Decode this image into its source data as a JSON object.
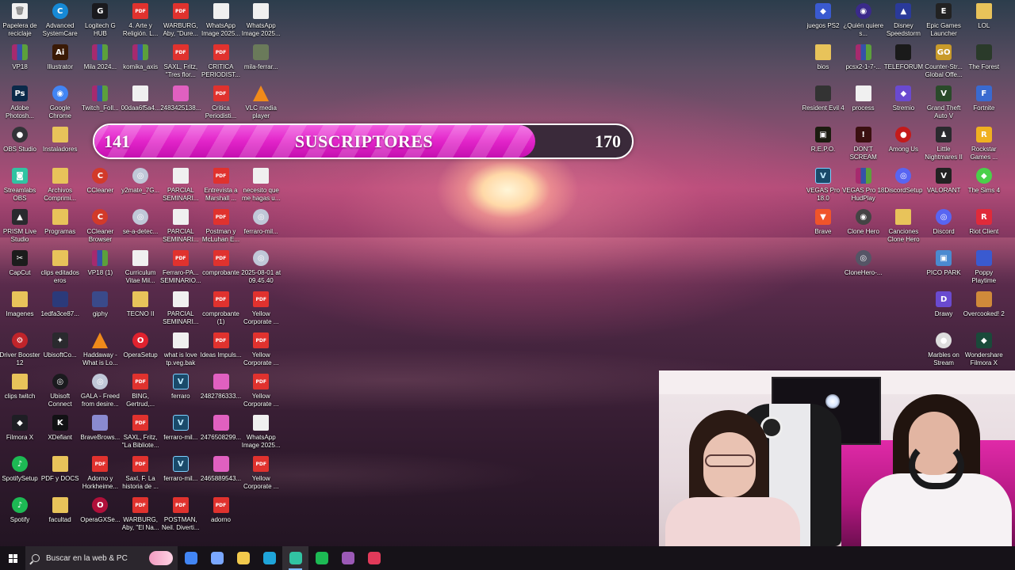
{
  "subscriber_bar": {
    "start_value": "141",
    "label": "SUSCRIPTORES",
    "goal_value": "170",
    "progress_fraction": 0.82
  },
  "taskbar": {
    "search_placeholder": "Buscar en la web & PC",
    "apps": [
      {
        "name": "chrome-app",
        "color": "#4285f4"
      },
      {
        "name": "copilot-app",
        "color": "#7aa7ff"
      },
      {
        "name": "file-explorer-app",
        "color": "#f2c94c"
      },
      {
        "name": "edge-app",
        "color": "#1fa4d9"
      },
      {
        "name": "streamlabs-app",
        "color": "#31c3a2"
      },
      {
        "name": "spotify-app",
        "color": "#1db954"
      },
      {
        "name": "obs-app",
        "color": "#9b59b6"
      },
      {
        "name": "capcut-app",
        "color": "#e23a5a"
      }
    ]
  },
  "desktop_icons": [
    {
      "label": "Papelera de reciclaje",
      "glyph": "🗑",
      "kind": "doc",
      "col": 0,
      "row": 0
    },
    {
      "label": "VP18",
      "glyph": "",
      "kind": "rar",
      "col": 0,
      "row": 1
    },
    {
      "label": "Adobe Photosh...",
      "glyph": "Ps",
      "kind": "app",
      "color": "#0b2a4a",
      "col": 0,
      "row": 2
    },
    {
      "label": "OBS Studio",
      "glyph": "●",
      "kind": "circ",
      "color": "#333338",
      "col": 0,
      "row": 3
    },
    {
      "label": "Streamlabs OBS",
      "glyph": "◙",
      "kind": "app",
      "color": "#31c3a2",
      "col": 0,
      "row": 4
    },
    {
      "label": "PRISM Live Studio",
      "glyph": "▲",
      "kind": "app",
      "color": "#2a2a2e",
      "col": 0,
      "row": 5
    },
    {
      "label": "CapCut",
      "glyph": "✂",
      "kind": "app",
      "color": "#1c1c1c",
      "col": 0,
      "row": 6
    },
    {
      "label": "Imagenes",
      "glyph": "",
      "kind": "folder",
      "col": 0,
      "row": 7
    },
    {
      "label": "Driver Booster 12",
      "glyph": "⚙",
      "kind": "circ",
      "color": "#c0242a",
      "col": 0,
      "row": 8
    },
    {
      "label": "clips twitch",
      "glyph": "",
      "kind": "folder",
      "col": 0,
      "row": 9
    },
    {
      "label": "Filmora X",
      "glyph": "◆",
      "kind": "app",
      "color": "#1e1e24",
      "col": 0,
      "row": 10
    },
    {
      "label": "SpotifySetup",
      "glyph": "♪",
      "kind": "circ",
      "color": "#1db954",
      "col": 0,
      "row": 11
    },
    {
      "label": "Spotify",
      "glyph": "♪",
      "kind": "circ",
      "color": "#1db954",
      "col": 0,
      "row": 12
    },
    {
      "label": "Advanced SystemCare",
      "glyph": "C",
      "kind": "circ",
      "color": "#1689d6",
      "col": 1,
      "row": 0
    },
    {
      "label": "Illustrator",
      "glyph": "Ai",
      "kind": "app",
      "color": "#3a1a06",
      "col": 1,
      "row": 1
    },
    {
      "label": "Google Chrome",
      "glyph": "◉",
      "kind": "circ",
      "color": "#4285f4",
      "col": 1,
      "row": 2
    },
    {
      "label": "Instaladores",
      "glyph": "",
      "kind": "folder",
      "col": 1,
      "row": 3
    },
    {
      "label": "Archivos Comprimi...",
      "glyph": "",
      "kind": "folder",
      "col": 1,
      "row": 4
    },
    {
      "label": "Programas",
      "glyph": "",
      "kind": "folder",
      "col": 1,
      "row": 5
    },
    {
      "label": "clips editados eros",
      "glyph": "",
      "kind": "folder",
      "col": 1,
      "row": 6
    },
    {
      "label": "1edfa3ce87...",
      "glyph": "",
      "kind": "app",
      "color": "#2b3a7a",
      "col": 1,
      "row": 7
    },
    {
      "label": "UbisoftCo...",
      "glyph": "✦",
      "kind": "app",
      "color": "#2a2a2e",
      "col": 1,
      "row": 8
    },
    {
      "label": "Ubisoft Connect",
      "glyph": "◎",
      "kind": "circ",
      "color": "#1a1a1e",
      "col": 1,
      "row": 9
    },
    {
      "label": "XDefiant",
      "glyph": "K",
      "kind": "app",
      "color": "#111114",
      "col": 1,
      "row": 10
    },
    {
      "label": "PDF y DOCS",
      "glyph": "",
      "kind": "folder",
      "col": 1,
      "row": 11
    },
    {
      "label": "facultad",
      "glyph": "",
      "kind": "folder",
      "col": 1,
      "row": 12
    },
    {
      "label": "Logitech G HUB",
      "glyph": "G",
      "kind": "app",
      "color": "#1a1a1e",
      "col": 2,
      "row": 0
    },
    {
      "label": "Mila 2024...",
      "glyph": "",
      "kind": "rar",
      "col": 2,
      "row": 1
    },
    {
      "label": "Twitch_Foll...",
      "glyph": "",
      "kind": "rar",
      "col": 2,
      "row": 2
    },
    {
      "label": "CCleaner",
      "glyph": "C",
      "kind": "circ",
      "color": "#d23a2a",
      "col": 2,
      "row": 4
    },
    {
      "label": "CCleaner Browser",
      "glyph": "C",
      "kind": "circ",
      "color": "#d23a2a",
      "col": 2,
      "row": 5
    },
    {
      "label": "VP18 (1)",
      "glyph": "",
      "kind": "rar",
      "col": 2,
      "row": 6
    },
    {
      "label": "giphy",
      "glyph": "",
      "kind": "app",
      "color": "#3a4a8a",
      "col": 2,
      "row": 7
    },
    {
      "label": "Haddaway - What is Lo...",
      "glyph": "",
      "kind": "vlc",
      "col": 2,
      "row": 8
    },
    {
      "label": "GALA - Freed from desire...",
      "glyph": "◎",
      "kind": "circ",
      "color": "#c0c8d8",
      "col": 2,
      "row": 9
    },
    {
      "label": "BraveBrows...",
      "glyph": "",
      "kind": "app",
      "color": "#8a8ad0",
      "col": 2,
      "row": 10
    },
    {
      "label": "Adorno y Horkheime...",
      "glyph": "PDF",
      "kind": "pdf",
      "col": 2,
      "row": 11
    },
    {
      "label": "OperaGXSe...",
      "glyph": "O",
      "kind": "circ",
      "color": "#b0103a",
      "col": 2,
      "row": 12
    },
    {
      "label": "4. Arte y Religión. L...",
      "glyph": "PDF",
      "kind": "pdf",
      "col": 3,
      "row": 0
    },
    {
      "label": "komika_axis",
      "glyph": "",
      "kind": "rar",
      "col": 3,
      "row": 1
    },
    {
      "label": "00daa6f5a4...",
      "glyph": "",
      "kind": "doc",
      "col": 3,
      "row": 2
    },
    {
      "label": "y2mate_7G...",
      "glyph": "◎",
      "kind": "circ",
      "color": "#c0c8d8",
      "col": 3,
      "row": 4
    },
    {
      "label": "se-a-detec...",
      "glyph": "◎",
      "kind": "circ",
      "color": "#c0c8d8",
      "col": 3,
      "row": 5
    },
    {
      "label": "Curriculum Vitae Mil...",
      "glyph": "",
      "kind": "doc",
      "col": 3,
      "row": 6
    },
    {
      "label": "TECNO II",
      "glyph": "",
      "kind": "folder",
      "col": 3,
      "row": 7
    },
    {
      "label": "OperaSetup",
      "glyph": "O",
      "kind": "circ",
      "color": "#e0222e",
      "col": 3,
      "row": 8
    },
    {
      "label": "BING, Gertrud,...",
      "glyph": "PDF",
      "kind": "pdf",
      "col": 3,
      "row": 9
    },
    {
      "label": "SAXL, Fritz, \"La Bibliote...",
      "glyph": "PDF",
      "kind": "pdf",
      "col": 3,
      "row": 10
    },
    {
      "label": "Saxl, F. La historia de ...",
      "glyph": "PDF",
      "kind": "pdf",
      "col": 3,
      "row": 11
    },
    {
      "label": "WARBURG, Aby, \"El Na...",
      "glyph": "PDF",
      "kind": "pdf",
      "col": 3,
      "row": 12
    },
    {
      "label": "WARBURG, Aby, \"Dure...",
      "glyph": "PDF",
      "kind": "pdf",
      "col": 4,
      "row": 0
    },
    {
      "label": "SAXL, Fritz, \"Tres flor...",
      "glyph": "PDF",
      "kind": "pdf",
      "col": 4,
      "row": 1
    },
    {
      "label": "2483425138...",
      "glyph": "",
      "kind": "app",
      "color": "#e060c0",
      "col": 4,
      "row": 2
    },
    {
      "label": "PARCIAL SEMINARI...",
      "glyph": "",
      "kind": "doc",
      "col": 4,
      "row": 4
    },
    {
      "label": "PARCIAL SEMINARI...",
      "glyph": "",
      "kind": "doc",
      "col": 4,
      "row": 5
    },
    {
      "label": "Ferraro-PA... SEMINARIO...",
      "glyph": "PDF",
      "kind": "pdf",
      "col": 4,
      "row": 6
    },
    {
      "label": "PARCIAL SEMINARI...",
      "glyph": "",
      "kind": "doc",
      "col": 4,
      "row": 7
    },
    {
      "label": "what is love tp.veg.bak",
      "glyph": "",
      "kind": "doc",
      "col": 4,
      "row": 8
    },
    {
      "label": "ferraro",
      "glyph": "V",
      "kind": "vegas",
      "col": 4,
      "row": 9
    },
    {
      "label": "ferraro-mil...",
      "glyph": "V",
      "kind": "vegas",
      "col": 4,
      "row": 10
    },
    {
      "label": "ferraro-mil...",
      "glyph": "V",
      "kind": "vegas",
      "col": 4,
      "row": 11
    },
    {
      "label": "POSTMAN, Neil. Diverti...",
      "glyph": "PDF",
      "kind": "pdf",
      "col": 4,
      "row": 12
    },
    {
      "label": "WhatsApp Image 2025...",
      "glyph": "",
      "kind": "doc",
      "col": 5,
      "row": 0
    },
    {
      "label": "CRITICA PERIODIST...",
      "glyph": "PDF",
      "kind": "pdf",
      "col": 5,
      "row": 1
    },
    {
      "label": "Critica Periodisti...",
      "glyph": "PDF",
      "kind": "pdf",
      "col": 5,
      "row": 2
    },
    {
      "label": "Entrevista a Marshall ...",
      "glyph": "PDF",
      "kind": "pdf",
      "col": 5,
      "row": 4
    },
    {
      "label": "Postman y McLuhan E...",
      "glyph": "PDF",
      "kind": "pdf",
      "col": 5,
      "row": 5
    },
    {
      "label": "comprobante",
      "glyph": "PDF",
      "kind": "pdf",
      "col": 5,
      "row": 6
    },
    {
      "label": "comprobante (1)",
      "glyph": "PDF",
      "kind": "pdf",
      "col": 5,
      "row": 7
    },
    {
      "label": "Ideas Impuls...",
      "glyph": "PDF",
      "kind": "pdf",
      "col": 5,
      "row": 8
    },
    {
      "label": "2482786333...",
      "glyph": "",
      "kind": "app",
      "color": "#e060c0",
      "col": 5,
      "row": 9
    },
    {
      "label": "2476508299...",
      "glyph": "",
      "kind": "app",
      "color": "#e060c0",
      "col": 5,
      "row": 10
    },
    {
      "label": "2465889543...",
      "glyph": "",
      "kind": "app",
      "color": "#e060c0",
      "col": 5,
      "row": 11
    },
    {
      "label": "adorno",
      "glyph": "PDF",
      "kind": "pdf",
      "col": 5,
      "row": 12
    },
    {
      "label": "WhatsApp Image 2025...",
      "glyph": "",
      "kind": "doc",
      "col": 6,
      "row": 0
    },
    {
      "label": "mila-ferrar...",
      "glyph": "",
      "kind": "app",
      "color": "#6a7a5a",
      "col": 6,
      "row": 1
    },
    {
      "label": "VLC media player",
      "glyph": "",
      "kind": "vlc",
      "col": 6,
      "row": 2
    },
    {
      "label": "necesito que me hagas u...",
      "glyph": "",
      "kind": "doc",
      "col": 6,
      "row": 4
    },
    {
      "label": "ferraro-mil...",
      "glyph": "◎",
      "kind": "circ",
      "color": "#c0c8d8",
      "col": 6,
      "row": 5
    },
    {
      "label": "2025-08-01 at 09.45.40",
      "glyph": "◎",
      "kind": "circ",
      "color": "#c0c8d8",
      "col": 6,
      "row": 6
    },
    {
      "label": "Yellow Corporate ...",
      "glyph": "PDF",
      "kind": "pdf",
      "col": 6,
      "row": 7
    },
    {
      "label": "Yellow Corporate ...",
      "glyph": "PDF",
      "kind": "pdf",
      "col": 6,
      "row": 8
    },
    {
      "label": "Yellow Corporate ...",
      "glyph": "PDF",
      "kind": "pdf",
      "col": 6,
      "row": 9
    },
    {
      "label": "WhatsApp Image 2025...",
      "glyph": "",
      "kind": "doc",
      "col": 6,
      "row": 10
    },
    {
      "label": "Yellow Corporate ...",
      "glyph": "PDF",
      "kind": "pdf",
      "col": 6,
      "row": 11
    }
  ],
  "right_icons": [
    {
      "label": "juegos PS2",
      "glyph": "◆",
      "kind": "app",
      "color": "#3a5ad0",
      "col": 0,
      "row": 0
    },
    {
      "label": "bios",
      "glyph": "",
      "kind": "folder",
      "col": 0,
      "row": 1
    },
    {
      "label": "Resident Evil 4",
      "glyph": "",
      "kind": "app",
      "color": "#333",
      "col": 0,
      "row": 2
    },
    {
      "label": "R.E.P.O.",
      "glyph": "▣",
      "kind": "app",
      "color": "#1c1c10",
      "col": 0,
      "row": 3
    },
    {
      "label": "VEGAS Pro 18.0",
      "glyph": "V",
      "kind": "vegas",
      "col": 0,
      "row": 4
    },
    {
      "label": "Brave",
      "glyph": "▼",
      "kind": "app",
      "color": "#f0542a",
      "col": 0,
      "row": 5
    },
    {
      "label": "¿Quién quiere s...",
      "glyph": "◉",
      "kind": "circ",
      "color": "#3a2a8a",
      "col": 1,
      "row": 0
    },
    {
      "label": "pcsx2-1-7-...",
      "glyph": "",
      "kind": "rar",
      "col": 1,
      "row": 1
    },
    {
      "label": "process",
      "glyph": "",
      "kind": "doc",
      "col": 1,
      "row": 2
    },
    {
      "label": "DON'T SCREAM",
      "glyph": "!",
      "kind": "app",
      "color": "#3a1010",
      "col": 1,
      "row": 3
    },
    {
      "label": "VEGAS Pro 18 HudPlay",
      "glyph": "",
      "kind": "rar",
      "col": 1,
      "row": 4
    },
    {
      "label": "Clone Hero",
      "glyph": "◉",
      "kind": "circ",
      "color": "#444",
      "col": 1,
      "row": 5
    },
    {
      "label": "CloneHero-...",
      "glyph": "◎",
      "kind": "circ",
      "color": "#556",
      "col": 1,
      "row": 6
    },
    {
      "label": "Disney Speedstorm",
      "glyph": "▲",
      "kind": "app",
      "color": "#2a3a9a",
      "col": 2,
      "row": 0
    },
    {
      "label": "TELEFORUM",
      "glyph": "",
      "kind": "app",
      "color": "#1a1a1a",
      "col": 2,
      "row": 1
    },
    {
      "label": "Stremio",
      "glyph": "◆",
      "kind": "app",
      "color": "#6a4ad0",
      "col": 2,
      "row": 2
    },
    {
      "label": "Among Us",
      "glyph": "●",
      "kind": "circ",
      "color": "#c41a1a",
      "col": 2,
      "row": 3
    },
    {
      "label": "DiscordSetup",
      "glyph": "◎",
      "kind": "circ",
      "color": "#5865f2",
      "col": 2,
      "row": 4
    },
    {
      "label": "Canciones Clone Hero",
      "glyph": "",
      "kind": "folder",
      "col": 2,
      "row": 5
    },
    {
      "label": "Epic Games Launcher",
      "glyph": "E",
      "kind": "app",
      "color": "#222",
      "col": 3,
      "row": 0
    },
    {
      "label": "Counter-Str... Global Offe...",
      "glyph": "GO",
      "kind": "app",
      "color": "#c89a2a",
      "col": 3,
      "row": 1
    },
    {
      "label": "Grand Theft Auto V",
      "glyph": "V",
      "kind": "app",
      "color": "#2a4a2a",
      "col": 3,
      "row": 2
    },
    {
      "label": "Little Nightmares II",
      "glyph": "♟",
      "kind": "app",
      "color": "#2a2a2e",
      "col": 3,
      "row": 3
    },
    {
      "label": "VALORANT",
      "glyph": "V",
      "kind": "app",
      "color": "#222",
      "col": 3,
      "row": 4
    },
    {
      "label": "Discord",
      "glyph": "◎",
      "kind": "circ",
      "color": "#5865f2",
      "col": 3,
      "row": 5
    },
    {
      "label": "PICO PARK",
      "glyph": "▣",
      "kind": "app",
      "color": "#4a8ad0",
      "col": 3,
      "row": 6
    },
    {
      "label": "Drawy",
      "glyph": "D",
      "kind": "app",
      "color": "#6a4ad0",
      "col": 3,
      "row": 7
    },
    {
      "label": "Marbles on Stream",
      "glyph": "●",
      "kind": "circ",
      "color": "#ddd",
      "col": 3,
      "row": 8
    },
    {
      "label": "LOL",
      "glyph": "",
      "kind": "folder",
      "col": 4,
      "row": 0
    },
    {
      "label": "The Forest",
      "glyph": "",
      "kind": "app",
      "color": "#2a3a2a",
      "col": 4,
      "row": 1
    },
    {
      "label": "Fortnite",
      "glyph": "F",
      "kind": "app",
      "color": "#3a6ad0",
      "col": 4,
      "row": 2
    },
    {
      "label": "Rockstar Games ...",
      "glyph": "R",
      "kind": "app",
      "color": "#f0b020",
      "col": 4,
      "row": 3
    },
    {
      "label": "The Sims 4",
      "glyph": "◆",
      "kind": "circ",
      "color": "#4ad04a",
      "col": 4,
      "row": 4
    },
    {
      "label": "Riot Client",
      "glyph": "R",
      "kind": "app",
      "color": "#e02a3a",
      "col": 4,
      "row": 5
    },
    {
      "label": "Poppy Playtime",
      "glyph": "",
      "kind": "app",
      "color": "#3a5ad0",
      "col": 4,
      "row": 6
    },
    {
      "label": "Overcooked! 2",
      "glyph": "",
      "kind": "app",
      "color": "#d08a3a",
      "col": 4,
      "row": 7
    },
    {
      "label": "Wondershare Filmora X",
      "glyph": "◆",
      "kind": "app",
      "color": "#1a4a3a",
      "col": 4,
      "row": 8
    }
  ]
}
